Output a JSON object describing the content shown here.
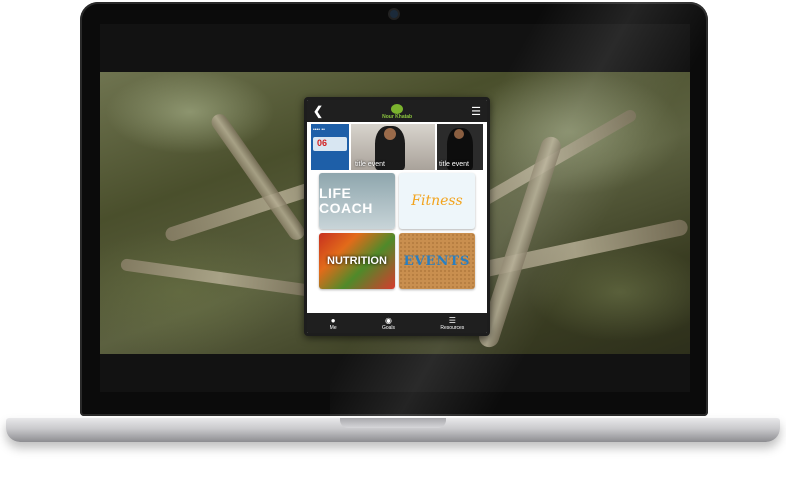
{
  "app": {
    "logo_text": "Nour Khatab",
    "back_icon": "back-arrow-icon",
    "menu_icon": "hamburger-menu-icon"
  },
  "carousel": [
    {
      "badge": "06",
      "caption": ""
    },
    {
      "caption": "title event"
    },
    {
      "caption": "title event"
    }
  ],
  "tiles": [
    {
      "label": "LIFE COACH"
    },
    {
      "label": "Fitness"
    },
    {
      "label": "NUTRITION"
    },
    {
      "label": "EVENTS"
    }
  ],
  "nav": [
    {
      "label": "Me",
      "icon": "person-icon"
    },
    {
      "label": "Goals",
      "icon": "target-icon"
    },
    {
      "label": "Resources",
      "icon": "layers-icon"
    }
  ]
}
